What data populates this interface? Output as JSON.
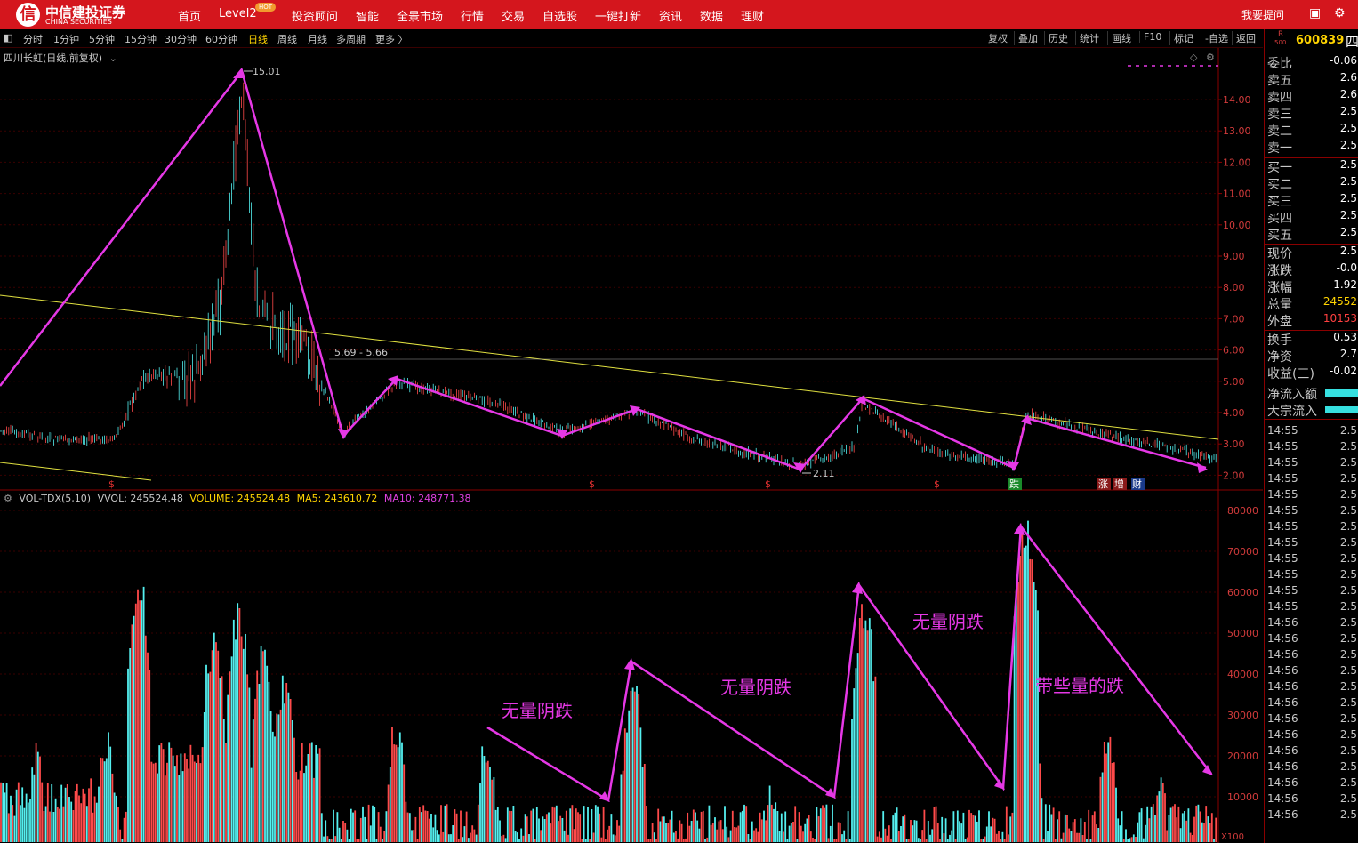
{
  "brand": {
    "cn": "中信建投证券",
    "en": "CHINA SECURITIES"
  },
  "nav": {
    "items": [
      "首页",
      "Level2",
      "投资顾问",
      "智能",
      "全景市场",
      "行情",
      "交易",
      "自选股",
      "一键打新",
      "资讯",
      "数据",
      "理财"
    ],
    "hot_badge": "HOT",
    "right": "我要提问"
  },
  "toolbar": {
    "periods": [
      "分时",
      "1分钟",
      "5分钟",
      "15分钟",
      "30分钟",
      "60分钟",
      "日线",
      "周线",
      "月线",
      "多周期",
      "更多 〉"
    ],
    "active": "日线",
    "tools": [
      "复权",
      "叠加",
      "历史",
      "统计",
      "画线",
      "F10",
      "标记",
      "-自选",
      "返回"
    ]
  },
  "chart": {
    "title": "四川长虹(日线,前复权)",
    "high_label": "15.01",
    "low_label": "2.11",
    "range_label": "5.69 - 5.66",
    "price_ticks": [
      "14.00",
      "13.00",
      "12.00",
      "11.00",
      "10.00",
      "9.00",
      "8.00",
      "7.00",
      "6.00",
      "5.00",
      "4.00",
      "3.00",
      "2.00"
    ],
    "markers": [
      {
        "t": "$",
        "color": "#e03030"
      },
      {
        "t": "$",
        "color": "#e03030"
      },
      {
        "t": "$",
        "color": "#e03030"
      },
      {
        "t": "$",
        "color": "#e03030"
      },
      {
        "t": "跌",
        "color": "#ffffff",
        "bg": "#1a8a2a"
      },
      {
        "t": "涨",
        "color": "#ffffff",
        "bg": "#8a1a1a"
      },
      {
        "t": "增",
        "color": "#ffffff",
        "bg": "#8a1a1a"
      },
      {
        "t": "财",
        "color": "#ffffff",
        "bg": "#1a3a8a"
      }
    ]
  },
  "volume": {
    "indicator": "VOL-TDX(5,10)",
    "vvol": "VVOL: 245524.48",
    "volume": "VOLUME: 245524.48",
    "ma5": "MA5: 243610.72",
    "ma10": "MA10: 248771.38",
    "ticks": [
      "80000",
      "70000",
      "60000",
      "50000",
      "40000",
      "30000",
      "20000",
      "10000"
    ],
    "unit": "X100",
    "annotations": [
      "无量阴跌",
      "无量阴跌",
      "无量阴跌",
      "带些量的跌"
    ]
  },
  "quote": {
    "market": "R",
    "market_sub": "500",
    "code": "600839",
    "name": "四",
    "rows": [
      {
        "label": "委比",
        "value": "-0.06",
        "color": "#ffffff"
      },
      {
        "label": "卖五",
        "value": "2.6",
        "color": "#ffffff"
      },
      {
        "label": "卖四",
        "value": "2.6",
        "color": "#ffffff"
      },
      {
        "label": "卖三",
        "value": "2.5",
        "color": "#ffffff"
      },
      {
        "label": "卖二",
        "value": "2.5",
        "color": "#ffffff"
      },
      {
        "label": "卖一",
        "value": "2.5",
        "color": "#ffffff"
      },
      {
        "label": "买一",
        "value": "2.5",
        "color": "#ffffff"
      },
      {
        "label": "买二",
        "value": "2.5",
        "color": "#ffffff"
      },
      {
        "label": "买三",
        "value": "2.5",
        "color": "#ffffff"
      },
      {
        "label": "买四",
        "value": "2.5",
        "color": "#ffffff"
      },
      {
        "label": "买五",
        "value": "2.5",
        "color": "#ffffff"
      },
      {
        "label": "现价",
        "value": "2.5",
        "color": "#ffffff"
      },
      {
        "label": "涨跌",
        "value": "-0.0",
        "color": "#ffffff"
      },
      {
        "label": "涨幅",
        "value": "-1.92",
        "color": "#ffffff"
      },
      {
        "label": "总量",
        "value": "24552",
        "color": "#ffd400"
      },
      {
        "label": "外盘",
        "value": "10153",
        "color": "#ff4040"
      },
      {
        "label": "换手",
        "value": "0.53",
        "color": "#ffffff"
      },
      {
        "label": "净资",
        "value": "2.7",
        "color": "#ffffff"
      },
      {
        "label": "收益(三)",
        "value": "-0.02",
        "color": "#ffffff"
      },
      {
        "label": "净流入额",
        "value": "",
        "color": "#36e0e0"
      },
      {
        "label": "大宗流入",
        "value": "",
        "color": "#36e0e0"
      }
    ],
    "ticks": [
      [
        "14:55",
        "2.5"
      ],
      [
        "14:55",
        "2.5"
      ],
      [
        "14:55",
        "2.5"
      ],
      [
        "14:55",
        "2.5"
      ],
      [
        "14:55",
        "2.5"
      ],
      [
        "14:55",
        "2.5"
      ],
      [
        "14:55",
        "2.5"
      ],
      [
        "14:55",
        "2.5"
      ],
      [
        "14:55",
        "2.5"
      ],
      [
        "14:55",
        "2.5"
      ],
      [
        "14:55",
        "2.5"
      ],
      [
        "14:55",
        "2.5"
      ],
      [
        "14:56",
        "2.5"
      ],
      [
        "14:56",
        "2.5"
      ],
      [
        "14:56",
        "2.5"
      ],
      [
        "14:56",
        "2.5"
      ],
      [
        "14:56",
        "2.5"
      ],
      [
        "14:56",
        "2.5"
      ],
      [
        "14:56",
        "2.5"
      ],
      [
        "14:56",
        "2.5"
      ],
      [
        "14:56",
        "2.5"
      ],
      [
        "14:56",
        "2.5"
      ],
      [
        "14:56",
        "2.5"
      ],
      [
        "14:56",
        "2.5"
      ],
      [
        "14:56",
        "2.5"
      ]
    ]
  }
}
